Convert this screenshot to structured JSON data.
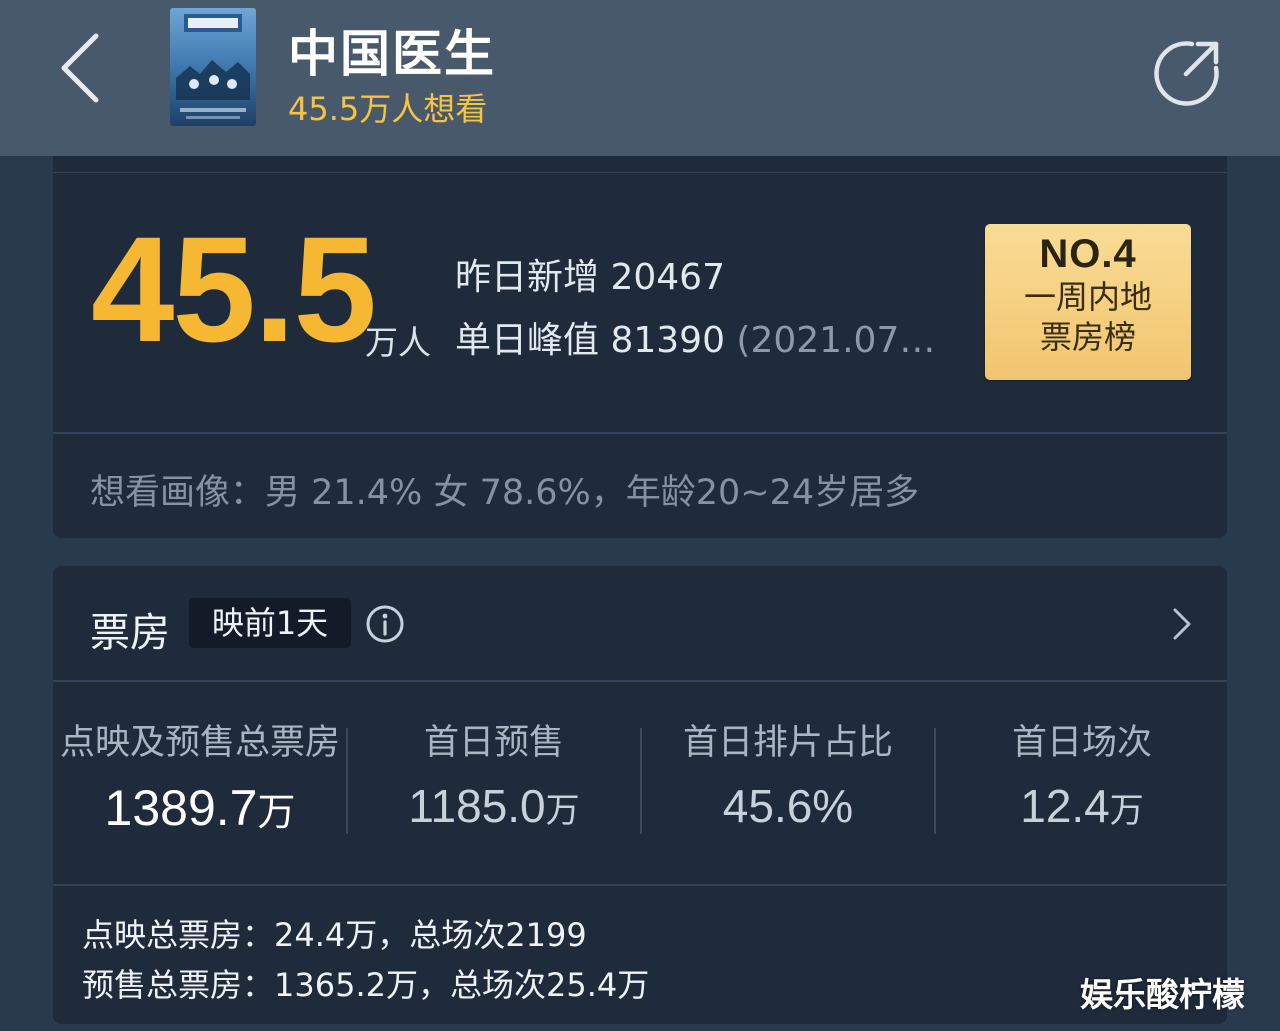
{
  "header": {
    "title": "中国医生",
    "want_count": "45.5万人想看",
    "back_icon": "chevron-left-icon",
    "share_icon": "share-icon"
  },
  "want_card": {
    "big_number": "45.5",
    "big_unit": "万人",
    "yesterday_label": "昨日新增 ",
    "yesterday_value": "20467",
    "peak_label": "单日峰值 ",
    "peak_value": "81390",
    "peak_date": " (2021.07…",
    "rank_no": "NO.4",
    "rank_line1": "一周内地",
    "rank_line2": "票房榜",
    "portrait": "想看画像：男 21.4%  女 78.6%，年龄20~24岁居多"
  },
  "box_office": {
    "title": "票房",
    "tag": "映前1天",
    "metrics": [
      {
        "label": "点映及预售总票房",
        "value": "1389.7",
        "unit": "万"
      },
      {
        "label": "首日预售",
        "value": "1185.0",
        "unit": "万"
      },
      {
        "label": "首日排片占比",
        "value": "45.6%",
        "unit": ""
      },
      {
        "label": "首日场次",
        "value": "12.4",
        "unit": "万"
      }
    ],
    "detail_line1": "点映总票房：24.4万，总场次2199",
    "detail_line2": "预售总票房：1365.2万，总场次25.4万"
  },
  "watermark": "娱乐酸柠檬",
  "colors": {
    "accent_gold": "#f6b733",
    "header_bg": "#48596b",
    "card_bg": "#1f2b3b",
    "badge_gold": "#f1c56f"
  }
}
